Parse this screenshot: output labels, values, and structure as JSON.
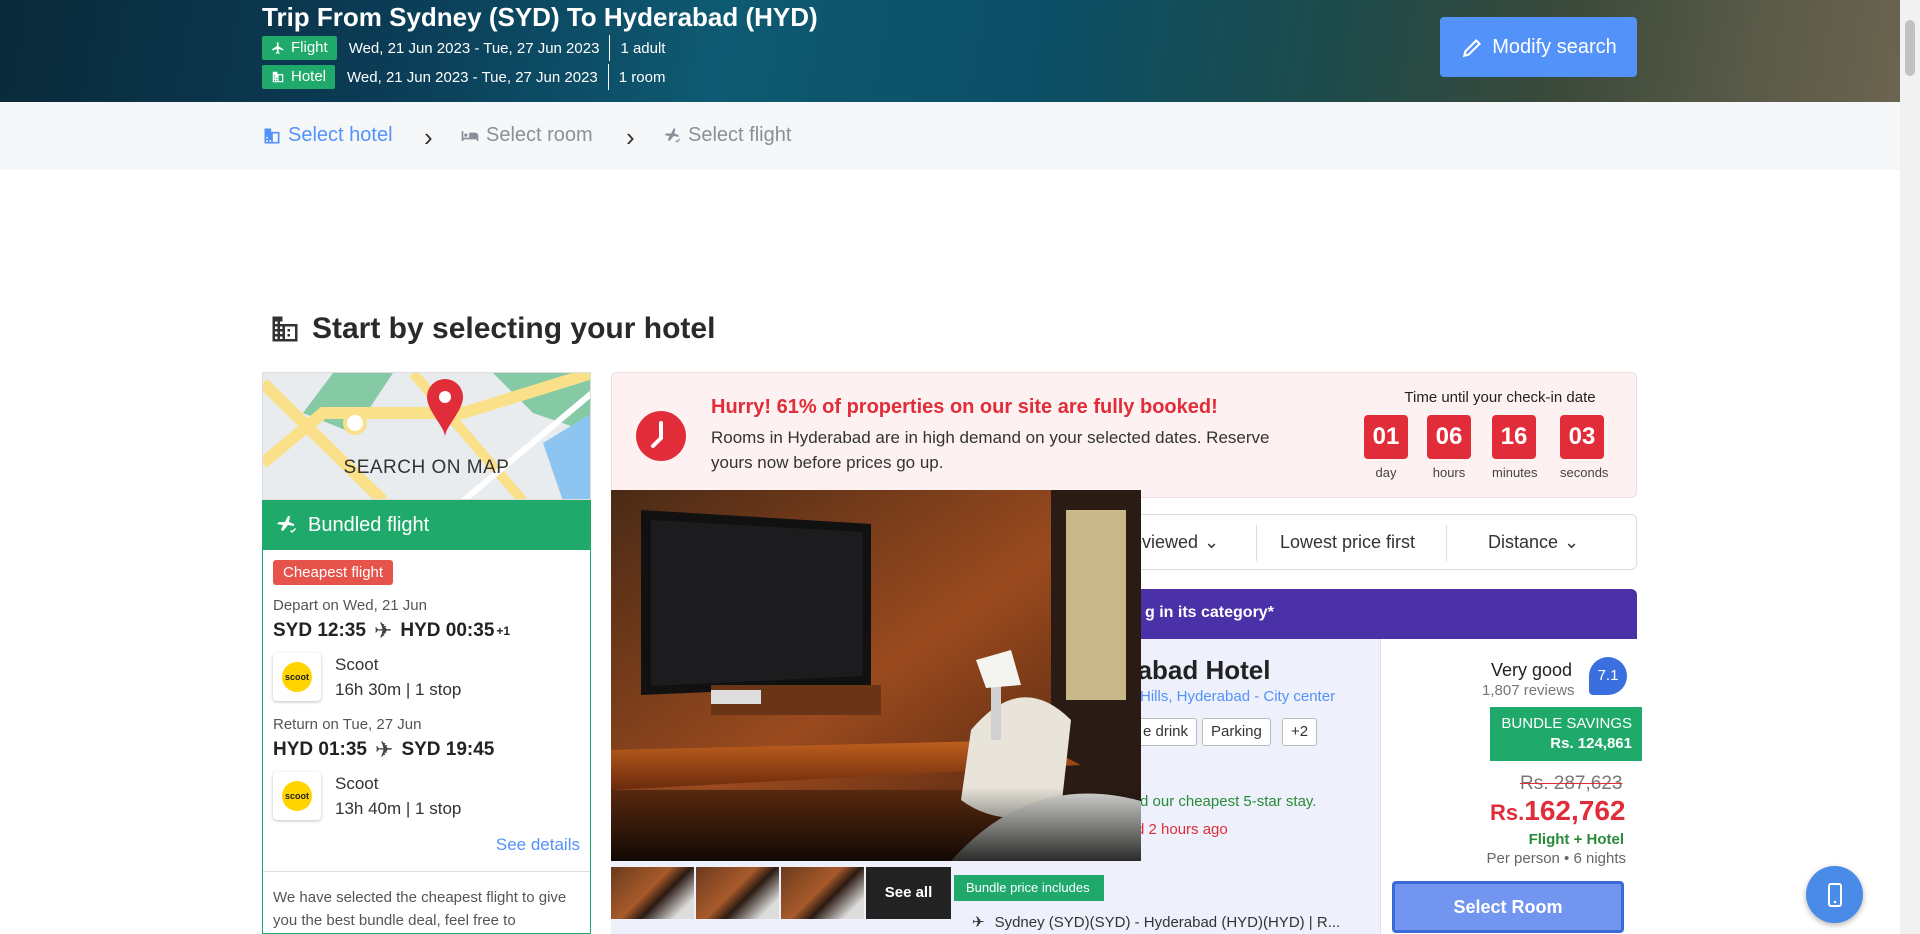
{
  "header": {
    "title": "Trip From Sydney (SYD) To Hyderabad (HYD)",
    "flight_tag": "Flight",
    "flight_dates": "Wed, 21 Jun 2023 - Tue, 27 Jun 2023",
    "flight_pax": "1 adult",
    "hotel_tag": "Hotel",
    "hotel_dates": "Wed, 21 Jun 2023 - Tue, 27 Jun 2023",
    "hotel_rooms": "1 room",
    "modify_label": "Modify search"
  },
  "steps": [
    {
      "label": "Select hotel",
      "icon": "hotel-icon"
    },
    {
      "label": "Select room",
      "icon": "bed-icon"
    },
    {
      "label": "Select flight",
      "icon": "flight-check-icon"
    }
  ],
  "section_title": "Start by selecting your hotel",
  "map": {
    "label": "SEARCH ON MAP"
  },
  "bundle": {
    "title": "Bundled flight",
    "badge": "Cheapest flight",
    "depart_label": "Depart on Wed, 21 Jun",
    "depart_from": "SYD 12:35",
    "depart_to": "HYD 00:35",
    "depart_plus": "+1",
    "depart_airline": "Scoot",
    "depart_duration": "16h 30m",
    "depart_stops": "1 stop",
    "return_label": "Return on Tue, 27 Jun",
    "return_from": "HYD 01:35",
    "return_to": "SYD 19:45",
    "return_airline": "Scoot",
    "return_duration": "13h 40m",
    "return_stops": "1 stop",
    "airline_logo_text": "scoot",
    "see_details": "See details",
    "note": "We have selected the cheapest flight to give you the best bundle deal, feel free to"
  },
  "hurry": {
    "title": "Hurry! 61% of properties on our site are fully booked!",
    "text": "Rooms in Hyderabad are in high demand on your selected dates. Reserve yours now before prices go up.",
    "countdown_label": "Time until your check-in date",
    "countdown": [
      {
        "value": "01",
        "unit": "day"
      },
      {
        "value": "06",
        "unit": "hours"
      },
      {
        "value": "16",
        "unit": "minutes"
      },
      {
        "value": "03",
        "unit": "seconds"
      }
    ]
  },
  "sort": {
    "reviewed": "eviewed",
    "lowest": "Lowest price first",
    "distance": "Distance"
  },
  "banner_text": "g in its category*",
  "hotel": {
    "name": "erabad Hotel",
    "location": "Hills, Hyderabad - City center",
    "chips": [
      "e drink",
      "Parking",
      "+2"
    ],
    "green_note": "d our cheapest 5-star stay.",
    "red_note": "d 2 hours ago",
    "rating_word": "Very good",
    "reviews": "1,807 reviews",
    "score": "7.1",
    "savings_label": "BUNDLE SAVINGS",
    "savings_value": "Rs. 124,861",
    "old_price": "Rs. 287,623",
    "currency": "Rs.",
    "new_price": "162,762",
    "price_type": "Flight + Hotel",
    "price_per": "Per person • 6 nights",
    "select_label": "Select Room",
    "bundle_includes": "Bundle price includes",
    "route": "Sydney (SYD)(SYD) - Hyderabad (HYD)(HYD) | R..."
  },
  "gallery": {
    "see_all": "See all"
  }
}
